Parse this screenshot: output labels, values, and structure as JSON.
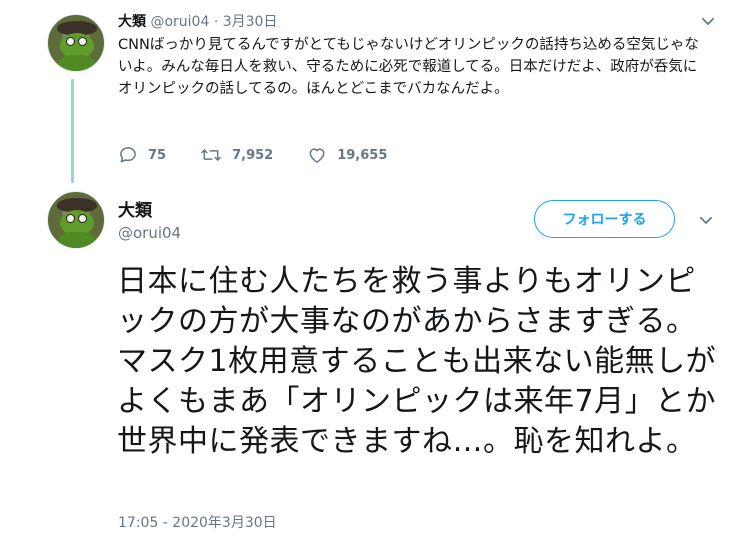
{
  "tweet1": {
    "name": "大類",
    "handle": "@orui04",
    "separator": "·",
    "date": "3月30日",
    "text": "CNNばっかり見てるんですがとてもじゃないけどオリンピックの話持ち込める空気じゃないよ。みんな毎日人を救い、守るために必死で報道してる。日本だけだよ、政府が呑気にオリンピックの話してるの。ほんとどこまでバカなんだよ。",
    "replies": "75",
    "retweets": "7,952",
    "likes": "19,655"
  },
  "tweet2": {
    "name": "大類",
    "handle": "@orui04",
    "follow_label": "フォローする",
    "text": "日本に住む人たちを救う事よりもオリンピックの方が大事なのがあからさますぎる。マスク1枚用意することも出来ない能無しがよくもまあ「オリンピックは来年7月」とか世界中に発表できますね…。恥を知れよ。",
    "timestamp": "17:05 - 2020年3月30日"
  },
  "icons": {
    "reply": "reply-icon",
    "retweet": "retweet-icon",
    "like": "heart-icon",
    "menu": "chevron-down-icon"
  },
  "colors": {
    "accent": "#1da1f2",
    "muted": "#657786",
    "thread_line": "#8fd6e0"
  }
}
